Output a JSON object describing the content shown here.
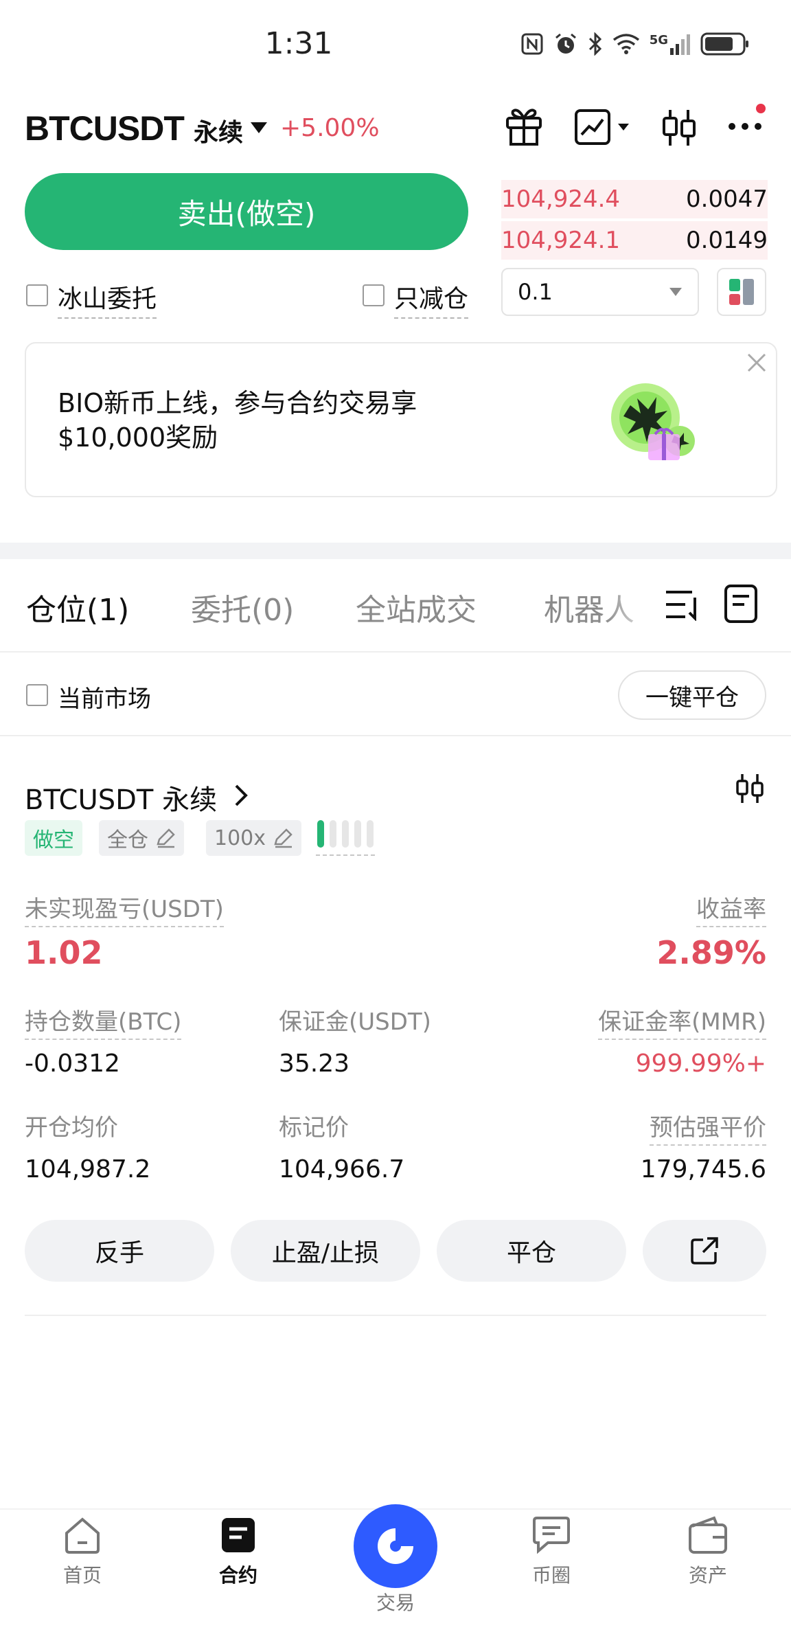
{
  "status_bar": {
    "time": "1:31",
    "network": "5G"
  },
  "header": {
    "symbol": "BTCUSDT",
    "contract_type": "永续",
    "change": "+5.00%",
    "icons": [
      "gift-icon",
      "chart-mode-icon",
      "candlestick-icon",
      "more-icon"
    ]
  },
  "trade": {
    "sell_label": "卖出(做空)",
    "iceberg_label": "冰山委托",
    "reduce_only_label": "只减仓",
    "quantity_value": "0.1"
  },
  "order_book": {
    "asks": [
      {
        "price": "104,924.4",
        "qty": "0.0047"
      },
      {
        "price": "104,924.1",
        "qty": "0.0149"
      }
    ]
  },
  "banner": {
    "line1": "BIO新币上线，参与合约交易享",
    "line2": "$10,000奖励"
  },
  "tabs": {
    "positions": "仓位(1)",
    "orders": "委托(0)",
    "trades": "全站成交",
    "bots": "机器人"
  },
  "filter": {
    "current_market_label": "当前市场",
    "close_all_label": "一键平仓"
  },
  "position": {
    "title": "BTCUSDT 永续",
    "side_tag": "做空",
    "margin_mode_tag": "全仓",
    "leverage_tag": "100x",
    "pnl_label": "未实现盈亏(USDT)",
    "pnl_value": "1.02",
    "roe_label": "收益率",
    "roe_value": "2.89%",
    "size_label": "持仓数量(BTC)",
    "size_value": "-0.0312",
    "margin_label": "保证金(USDT)",
    "margin_value": "35.23",
    "mmr_label": "保证金率(MMR)",
    "mmr_value": "999.99%+",
    "entry_label": "开仓均价",
    "entry_value": "104,987.2",
    "mark_label": "标记价",
    "mark_value": "104,966.7",
    "liq_label": "预估强平价",
    "liq_value": "179,745.6",
    "actions": {
      "reverse": "反手",
      "tpsl": "止盈/止损",
      "close": "平仓"
    }
  },
  "bottom_nav": {
    "home": "首页",
    "futures": "合约",
    "trade": "交易",
    "community": "币圈",
    "assets": "资产"
  },
  "colors": {
    "buy_green": "#25b574",
    "sell_red": "#e04e5e",
    "brand_blue": "#2e5bff"
  }
}
